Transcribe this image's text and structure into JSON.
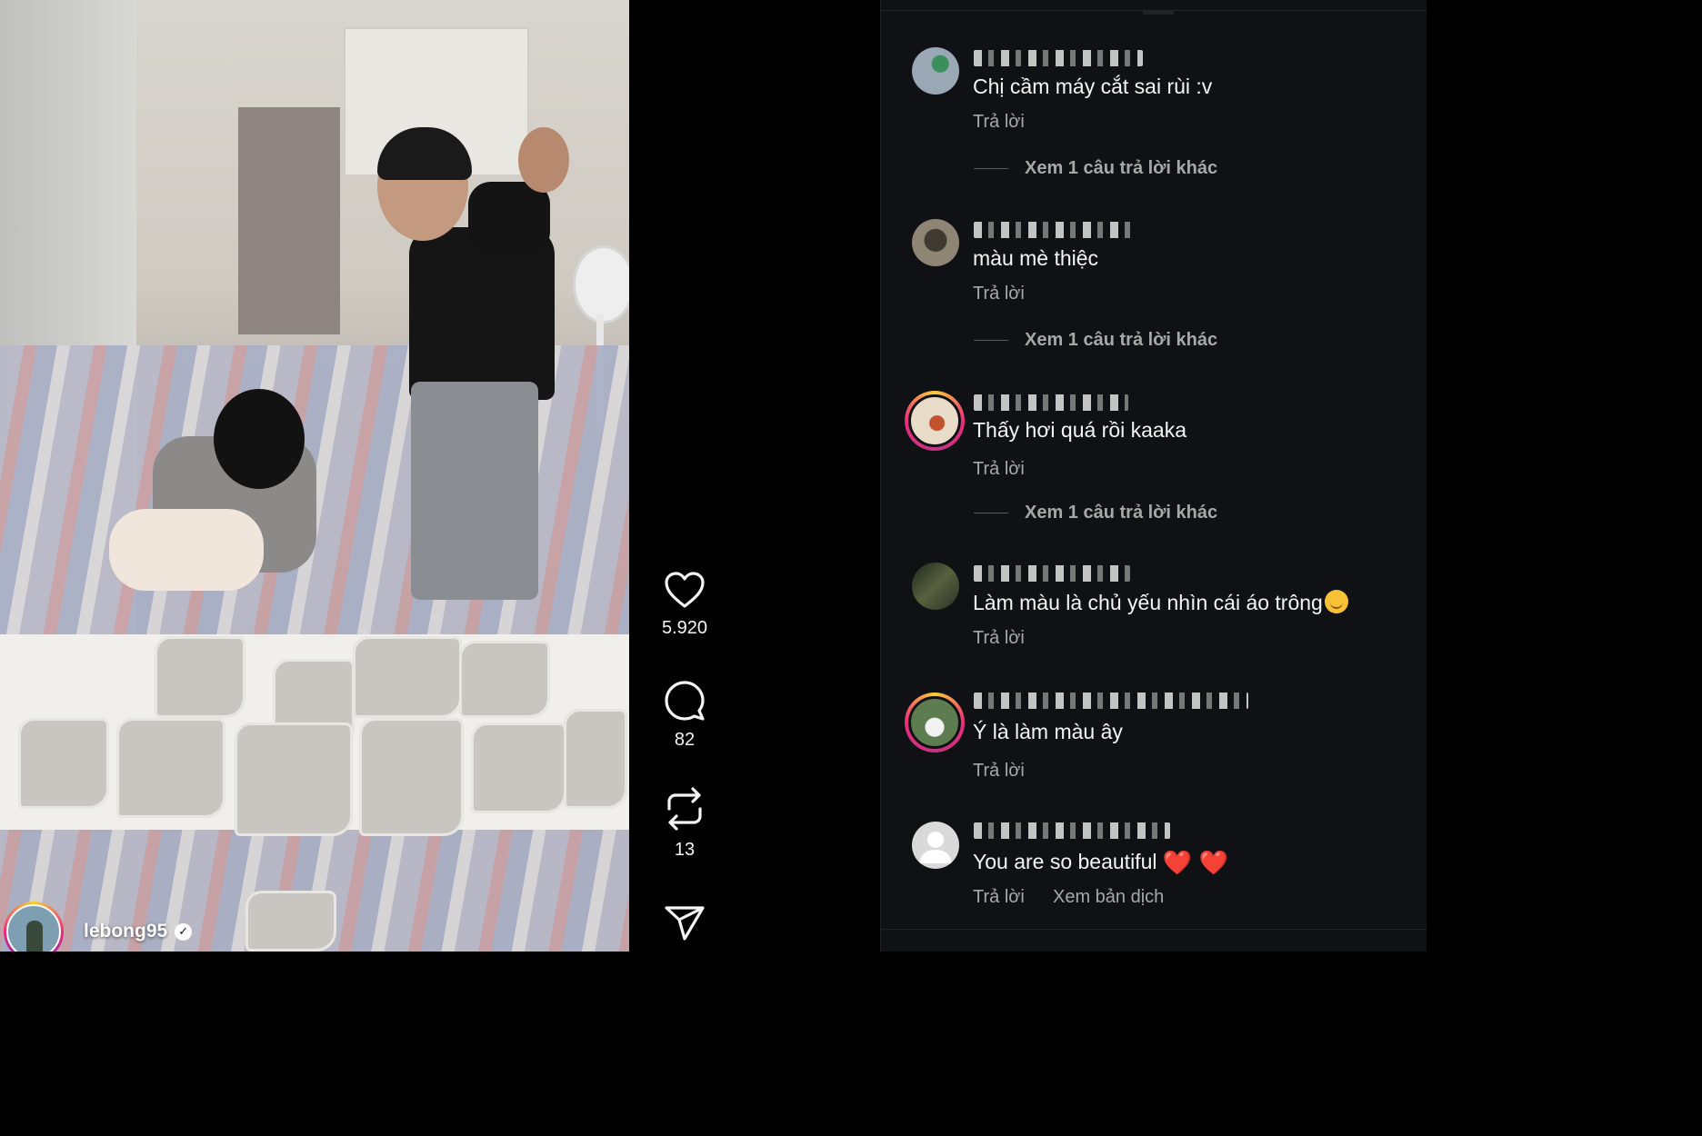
{
  "post": {
    "author_name": "lebong95",
    "verified_symbol": "✓"
  },
  "actions": {
    "likes": "5.920",
    "comments": "82",
    "reposts": "13",
    "icons": [
      "heart-icon",
      "comment-icon",
      "repost-icon",
      "share-icon"
    ]
  },
  "comments": [
    {
      "text": "Chị cầm máy cắt sai rùi :v",
      "reply": "Trả lời",
      "more_replies": "Xem 1 câu trả lời khác",
      "avatar_ring": false
    },
    {
      "text": "màu mè thiệc",
      "reply": "Trả lời",
      "more_replies": "Xem 1 câu trả lời khác",
      "avatar_ring": false
    },
    {
      "text": "Thấy hơi quá rồi kaaka",
      "reply": "Trả lời",
      "more_replies": "Xem 1 câu trả lời khác",
      "avatar_ring": true
    },
    {
      "text": "Làm màu là chủ yếu nhìn cái áo trông",
      "emoji": "😌",
      "reply": "Trả lời",
      "avatar_ring": false
    },
    {
      "text": "Ý là làm màu ây",
      "reply": "Trả lời",
      "avatar_ring": true
    },
    {
      "text": "You are so beautiful",
      "emoji": "❤️ ❤️",
      "reply": "Trả lời",
      "translate": "Xem bản dịch",
      "avatar_ring": false
    }
  ],
  "colors": {
    "background": "#000000",
    "comments_background": "#0f1114",
    "secondary_text": "#a8a8a8",
    "story_ring": "#ee2a7b"
  }
}
